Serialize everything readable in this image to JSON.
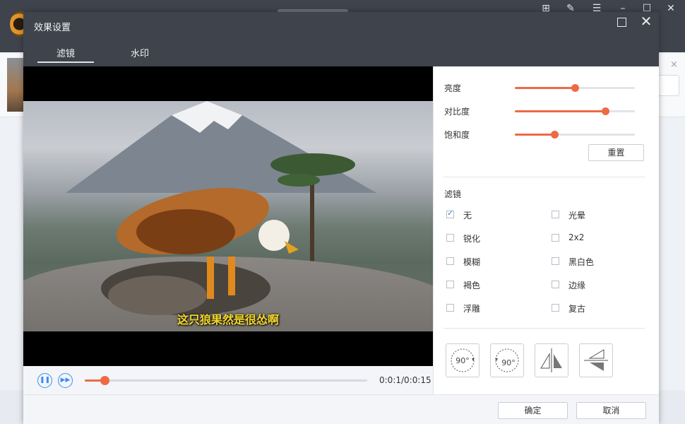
{
  "dialog": {
    "title": "效果设置"
  },
  "tabs": [
    {
      "label": "滤镜",
      "active": true
    },
    {
      "label": "水印",
      "active": false
    }
  ],
  "video": {
    "subtitle": "这只狼果然是很怂啊",
    "timecode": "0:0:1/0:0:15",
    "progress_fraction": 0.07
  },
  "adjust": [
    {
      "label": "亮度",
      "value_fraction": 0.5
    },
    {
      "label": "对比度",
      "value_fraction": 0.75
    },
    {
      "label": "饱和度",
      "value_fraction": 0.33
    }
  ],
  "reset_label": "重置",
  "filter_section_label": "滤镜",
  "filters": [
    {
      "label": "无",
      "checked": true
    },
    {
      "label": "光晕",
      "checked": false
    },
    {
      "label": "锐化",
      "checked": false
    },
    {
      "label": "2x2",
      "checked": false
    },
    {
      "label": "模糊",
      "checked": false
    },
    {
      "label": "黑白色",
      "checked": false
    },
    {
      "label": "褐色",
      "checked": false
    },
    {
      "label": "边缘",
      "checked": false
    },
    {
      "label": "浮雕",
      "checked": false
    },
    {
      "label": "复古",
      "checked": false
    }
  ],
  "tools": [
    {
      "name": "rotate-clockwise-icon",
      "text": "90°"
    },
    {
      "name": "rotate-counterclockwise-icon",
      "text": "90°"
    },
    {
      "name": "flip-horizontal-icon",
      "text": ""
    },
    {
      "name": "flip-vertical-icon",
      "text": ""
    }
  ],
  "footer": {
    "ok_label": "确定",
    "cancel_label": "取消"
  },
  "colors": {
    "accent": "#ee6a45",
    "titlebar": "#3f434c",
    "play_blue": "#3d8ef0"
  }
}
